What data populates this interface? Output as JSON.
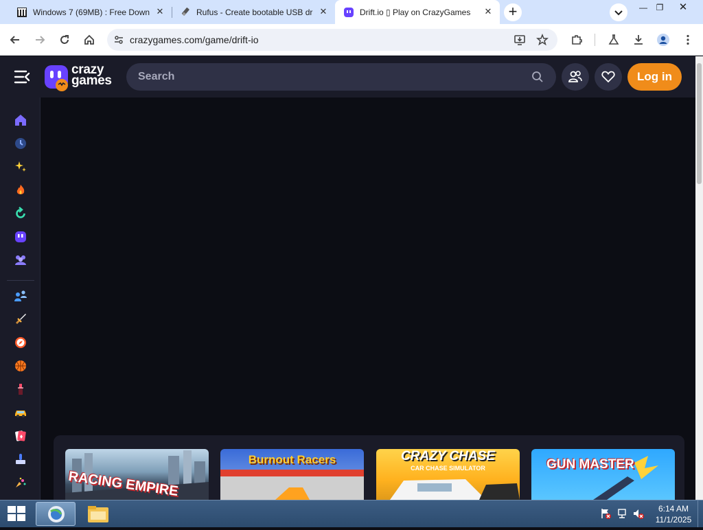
{
  "browser": {
    "tabs": [
      {
        "title": "Windows 7 (69MB) : Free Downl",
        "icon": "archive-icon",
        "active": false
      },
      {
        "title": "Rufus - Create bootable USB dr",
        "icon": "usb-drive-icon",
        "active": false
      },
      {
        "title": "Drift.io ▯ Play on CrazyGames",
        "icon": "crazygames-icon",
        "active": true
      }
    ],
    "address": "crazygames.com/game/drift-io"
  },
  "site": {
    "logo_line1": "crazy",
    "logo_line2": "games",
    "search_placeholder": "Search",
    "login_label": "Log in",
    "sidebar_icons": [
      "home-icon",
      "recent-icon",
      "new-icon",
      "trending-icon",
      "updated-icon",
      "originals-icon",
      "multiplayer-icon",
      "two-player-icon",
      "action-icon",
      "adventure-icon",
      "basketball-icon",
      "beauty-icon",
      "car-icon",
      "card-icon",
      "clicker-icon",
      "casual-icon"
    ]
  },
  "games": [
    {
      "title": "RACING EMPIRE"
    },
    {
      "title": "Burnout Racers"
    },
    {
      "title": "CRAZY CHASE",
      "subtitle": "CAR CHASE SIMULATOR"
    },
    {
      "title": "GUN MASTER"
    }
  ],
  "taskbar": {
    "time": "6:14 AM",
    "date": "11/1/2025"
  },
  "colors": {
    "accent_orange": "#f08c1a",
    "brand_purple": "#6842ff",
    "header_bg": "#1a1b28",
    "page_bg": "#0c0d14"
  }
}
